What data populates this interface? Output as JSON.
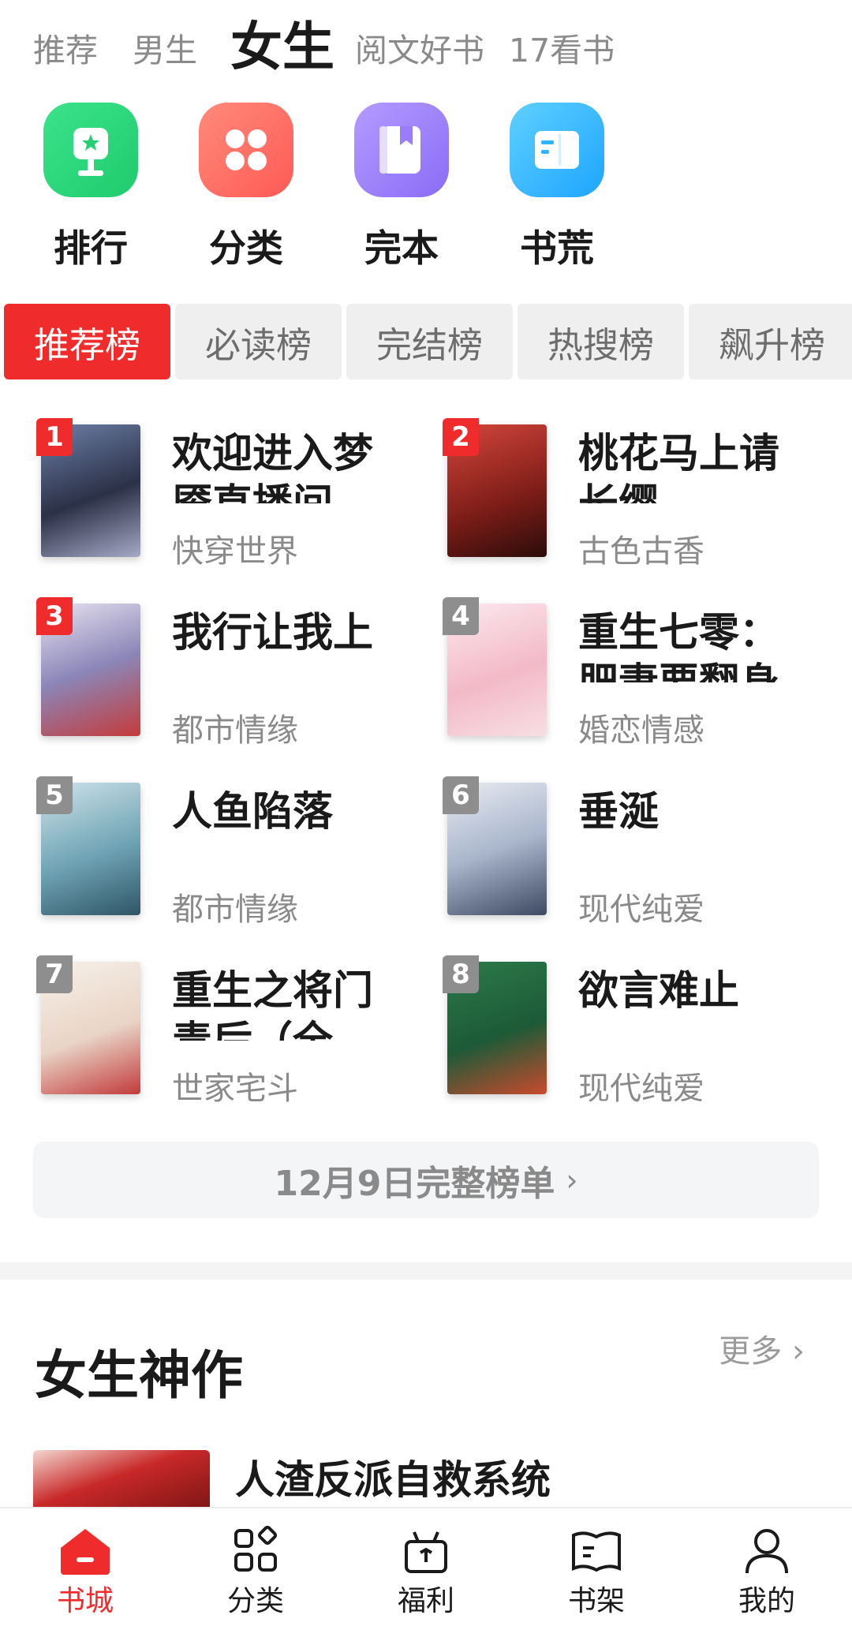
{
  "top_tabs": [
    {
      "label": "推荐"
    },
    {
      "label": "男生"
    },
    {
      "label": "女生",
      "active": true
    },
    {
      "label": "阅文好书"
    },
    {
      "label": "17看书"
    }
  ],
  "quick_entries": [
    {
      "label": "排行",
      "icon": "trophy-icon",
      "color": "#27d37a"
    },
    {
      "label": "分类",
      "icon": "grid-icon",
      "color": "#ff6a60"
    },
    {
      "label": "完本",
      "icon": "book-bookmark-icon",
      "color": "#9b7dfb"
    },
    {
      "label": "书荒",
      "icon": "open-book-icon",
      "color": "#2fb4ff"
    }
  ],
  "rank_tabs": [
    {
      "label": "推荐榜",
      "active": true
    },
    {
      "label": "必读榜"
    },
    {
      "label": "完结榜"
    },
    {
      "label": "热搜榜"
    },
    {
      "label": "飙升榜"
    }
  ],
  "rank_books": [
    {
      "rank": "1",
      "title": "欢迎进入梦魇直播间",
      "category": "快穿世界"
    },
    {
      "rank": "2",
      "title": "桃花马上请长缨",
      "category": "古色古香"
    },
    {
      "rank": "3",
      "title": "我行让我上",
      "category": "都市情缘"
    },
    {
      "rank": "4",
      "title": "重生七零：肥妻要翻身",
      "category": "婚恋情感"
    },
    {
      "rank": "5",
      "title": "人鱼陷落",
      "category": "都市情缘"
    },
    {
      "rank": "6",
      "title": "垂涎",
      "category": "现代纯爱"
    },
    {
      "rank": "7",
      "title": "重生之将门毒后（全",
      "category": "世家宅斗"
    },
    {
      "rank": "8",
      "title": "欲言难止",
      "category": "现代纯爱"
    }
  ],
  "full_list": {
    "label": "12月9日完整榜单",
    "chevron": "›"
  },
  "section": {
    "title": "女生神作",
    "more": "更多 ›"
  },
  "feature_book": {
    "title": "人渣反派自救系统"
  },
  "bottom_nav": [
    {
      "label": "书城",
      "active": true
    },
    {
      "label": "分类"
    },
    {
      "label": "福利"
    },
    {
      "label": "书架"
    },
    {
      "label": "我的"
    }
  ],
  "colors": {
    "accent": "#f02b2b"
  }
}
